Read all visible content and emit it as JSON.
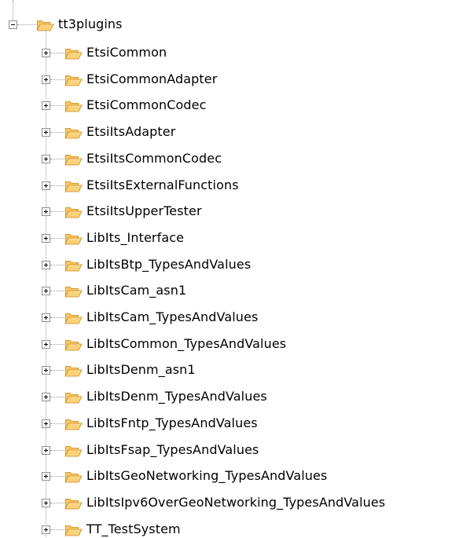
{
  "tree": {
    "root": {
      "label": "tt3plugins",
      "expanded": true,
      "icon": "folder-open-icon"
    },
    "children": [
      {
        "label": "EtsiCommon",
        "expanded": false
      },
      {
        "label": "EtsiCommonAdapter",
        "expanded": false
      },
      {
        "label": "EtsiCommonCodec",
        "expanded": false
      },
      {
        "label": "EtsiItsAdapter",
        "expanded": false
      },
      {
        "label": "EtsiItsCommonCodec",
        "expanded": false
      },
      {
        "label": "EtsiItsExternalFunctions",
        "expanded": false
      },
      {
        "label": "EtsiItsUpperTester",
        "expanded": false
      },
      {
        "label": "LibIts_Interface",
        "expanded": false
      },
      {
        "label": "LibItsBtp_TypesAndValues",
        "expanded": false
      },
      {
        "label": "LibItsCam_asn1",
        "expanded": false
      },
      {
        "label": "LibItsCam_TypesAndValues",
        "expanded": false
      },
      {
        "label": "LibItsCommon_TypesAndValues",
        "expanded": false
      },
      {
        "label": "LibItsDenm_asn1",
        "expanded": false
      },
      {
        "label": "LibItsDenm_TypesAndValues",
        "expanded": false
      },
      {
        "label": "LibItsFntp_TypesAndValues",
        "expanded": false
      },
      {
        "label": "LibItsFsap_TypesAndValues",
        "expanded": false
      },
      {
        "label": "LibItsGeoNetworking_TypesAndValues",
        "expanded": false
      },
      {
        "label": "LibItsIpv6OverGeoNetworking_TypesAndValues",
        "expanded": false
      },
      {
        "label": "TT_TestSystem",
        "expanded": false
      }
    ],
    "colors": {
      "folder_fill": "#f7c768",
      "folder_dark": "#d89b2b",
      "folder_light": "#fde7a7",
      "connector": "#9a9a9a"
    }
  }
}
